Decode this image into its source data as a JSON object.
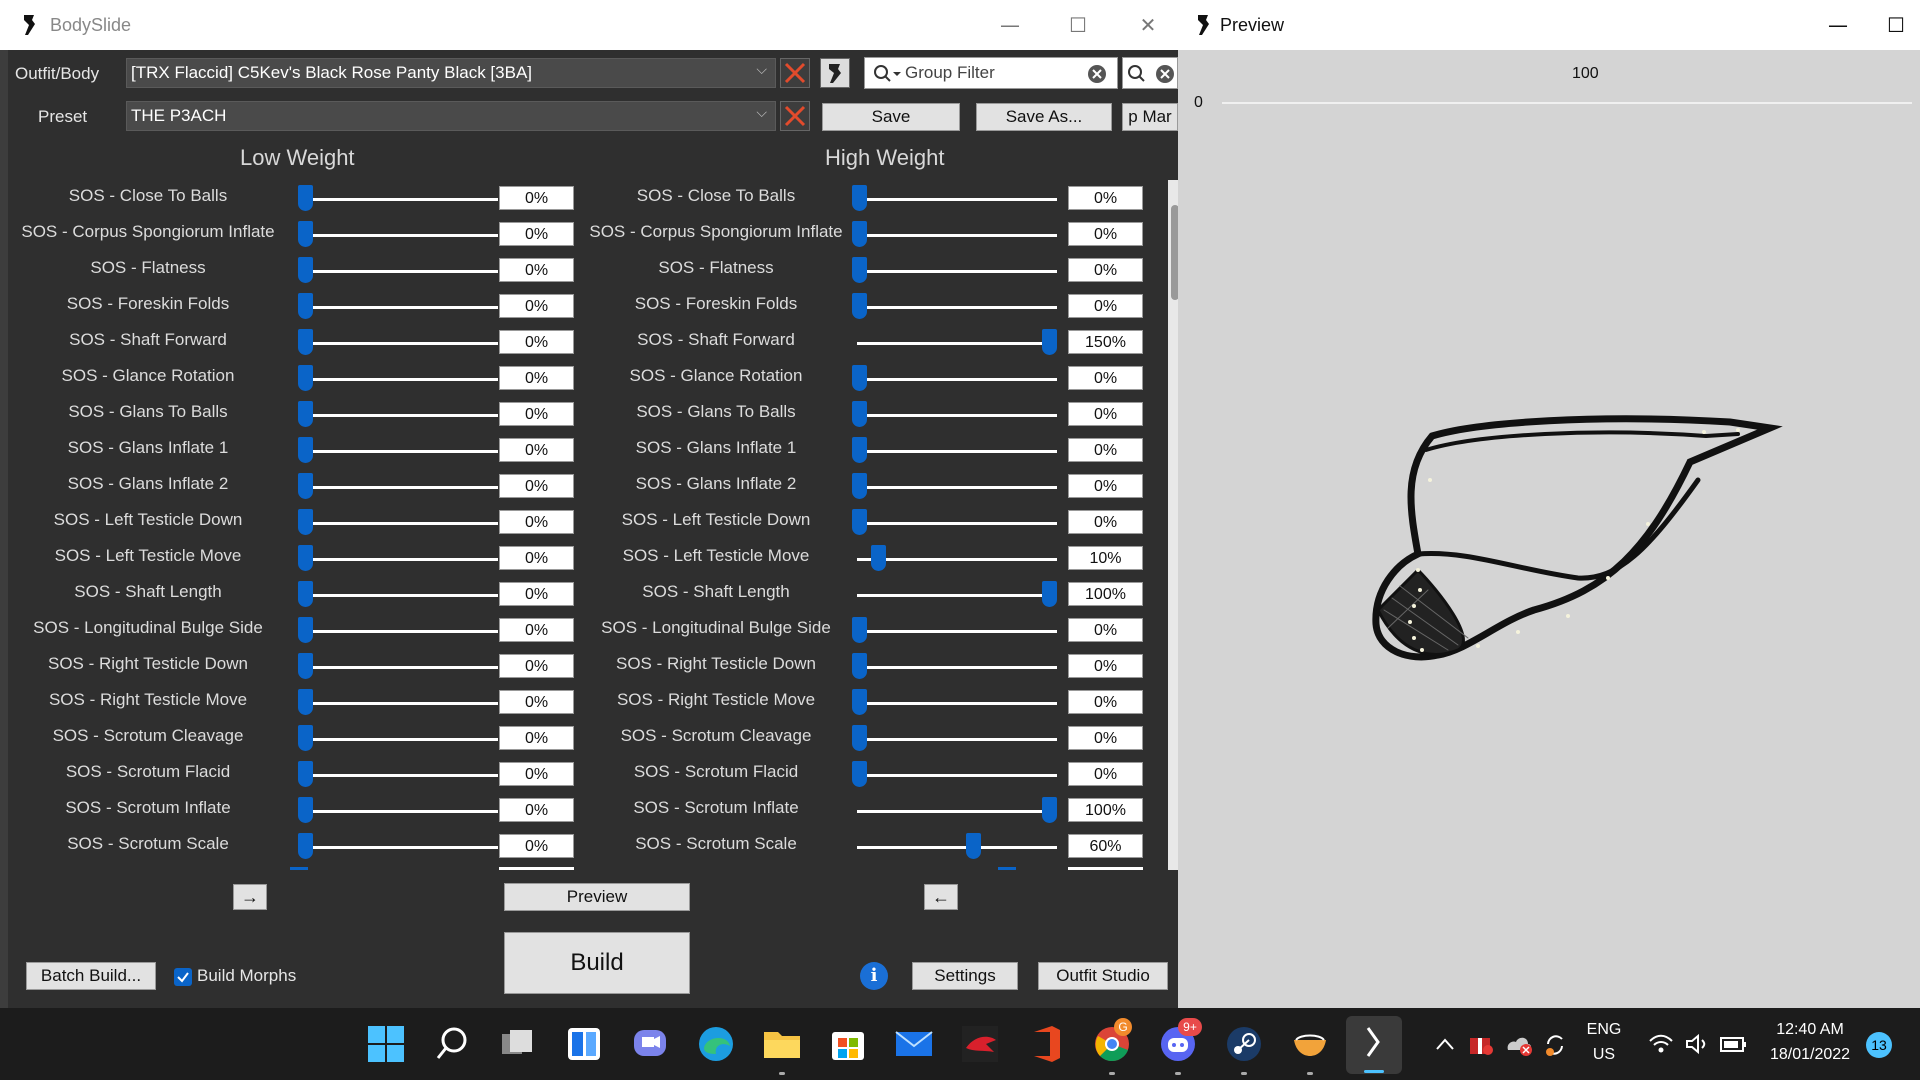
{
  "bodyslide": {
    "title": "BodySlide",
    "outfit_label": "Outfit/Body",
    "outfit_value": "[TRX Flaccid] C5Kev's Black Rose Panty Black [3BA]",
    "preset_label": "Preset",
    "preset_value": "THE P3ACH",
    "group_filter_placeholder": "Group Filter",
    "save_label": "Save",
    "save_as_label": "Save As...",
    "group_manager_label": "p Mar",
    "low_weight_header": "Low Weight",
    "high_weight_header": "High Weight",
    "sliders": [
      {
        "label": "SOS - Close To Balls",
        "low": "0%",
        "high": "0%",
        "low_pos": 0,
        "high_pos": 0
      },
      {
        "label": "SOS - Corpus Spongiorum Inflate",
        "low": "0%",
        "high": "0%",
        "low_pos": 0,
        "high_pos": 0
      },
      {
        "label": "SOS - Flatness",
        "low": "0%",
        "high": "0%",
        "low_pos": 0,
        "high_pos": 0
      },
      {
        "label": "SOS - Foreskin Folds",
        "low": "0%",
        "high": "0%",
        "low_pos": 0,
        "high_pos": 0
      },
      {
        "label": "SOS - Shaft Forward",
        "low": "0%",
        "high": "150%",
        "low_pos": 0,
        "high_pos": 1
      },
      {
        "label": "SOS - Glance Rotation",
        "low": "0%",
        "high": "0%",
        "low_pos": 0,
        "high_pos": 0
      },
      {
        "label": "SOS - Glans To Balls",
        "low": "0%",
        "high": "0%",
        "low_pos": 0,
        "high_pos": 0
      },
      {
        "label": "SOS - Glans Inflate 1",
        "low": "0%",
        "high": "0%",
        "low_pos": 0,
        "high_pos": 0
      },
      {
        "label": "SOS - Glans Inflate 2",
        "low": "0%",
        "high": "0%",
        "low_pos": 0,
        "high_pos": 0
      },
      {
        "label": "SOS - Left Testicle Down",
        "low": "0%",
        "high": "0%",
        "low_pos": 0,
        "high_pos": 0
      },
      {
        "label": "SOS - Left Testicle Move",
        "low": "0%",
        "high": "10%",
        "low_pos": 0,
        "high_pos": 0.1
      },
      {
        "label": "SOS - Shaft Length",
        "low": "0%",
        "high": "100%",
        "low_pos": 0,
        "high_pos": 1
      },
      {
        "label": "SOS - Longitudinal Bulge Side",
        "low": "0%",
        "high": "0%",
        "low_pos": 0,
        "high_pos": 0
      },
      {
        "label": "SOS - Right Testicle Down",
        "low": "0%",
        "high": "0%",
        "low_pos": 0,
        "high_pos": 0
      },
      {
        "label": "SOS - Right Testicle Move",
        "low": "0%",
        "high": "0%",
        "low_pos": 0,
        "high_pos": 0
      },
      {
        "label": "SOS - Scrotum Cleavage",
        "low": "0%",
        "high": "0%",
        "low_pos": 0,
        "high_pos": 0
      },
      {
        "label": "SOS - Scrotum Flacid",
        "low": "0%",
        "high": "0%",
        "low_pos": 0,
        "high_pos": 0
      },
      {
        "label": "SOS - Scrotum Inflate",
        "low": "0%",
        "high": "100%",
        "low_pos": 0,
        "high_pos": 1
      },
      {
        "label": "SOS - Scrotum Scale",
        "low": "0%",
        "high": "60%",
        "low_pos": 0,
        "high_pos": 0.6
      }
    ],
    "copy_low_to_high": "→",
    "copy_high_to_low": "←",
    "preview_label": "Preview",
    "build_label": "Build",
    "batch_build_label": "Batch Build...",
    "build_morphs_label": "Build Morphs",
    "build_morphs_checked": true,
    "settings_label": "Settings",
    "outfit_studio_label": "Outfit Studio"
  },
  "preview": {
    "title": "Preview",
    "weight_max": "100",
    "weight_min": "0"
  },
  "taskbar": {
    "apps": [
      "windows-start",
      "search",
      "task-view",
      "widgets",
      "teams-chat",
      "edge",
      "file-explorer",
      "microsoft-store",
      "mail",
      "vortex",
      "office",
      "chrome",
      "discord",
      "steam",
      "app-bowl",
      "bodyslide"
    ],
    "chrome_badge": "G",
    "discord_badge": "9+",
    "language_line1": "ENG",
    "language_line2": "US",
    "time": "12:40 AM",
    "date": "18/01/2022",
    "notification_count": "13"
  }
}
